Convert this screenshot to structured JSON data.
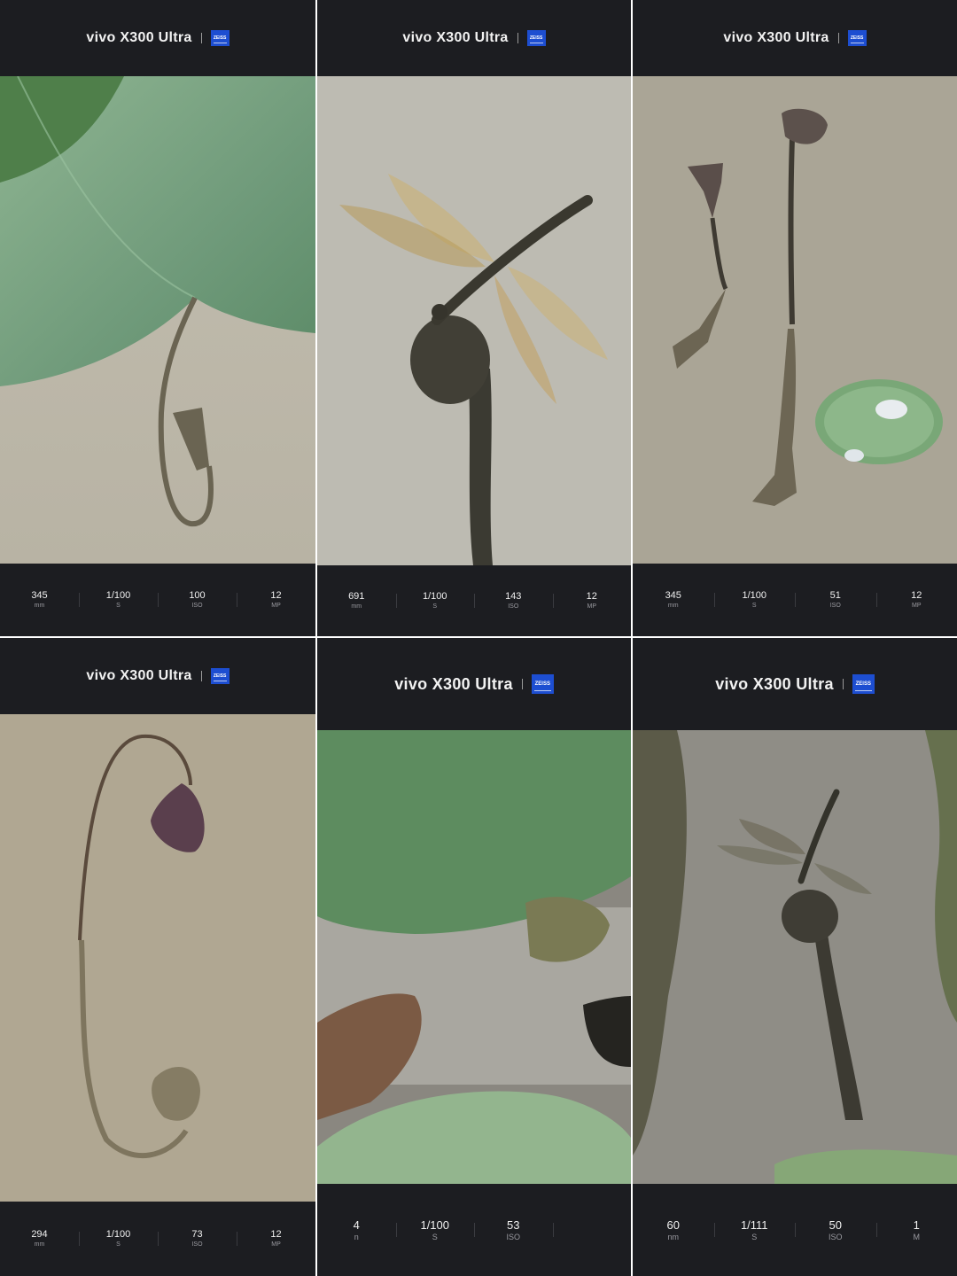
{
  "panels": [
    {
      "brand": "vivo X300 Ultra",
      "zeiss": "ZEISS",
      "stats": [
        {
          "value": "345",
          "unit": "mm"
        },
        {
          "value": "1/100",
          "unit": "S"
        },
        {
          "value": "100",
          "unit": "ISO"
        },
        {
          "value": "12",
          "unit": "MP"
        }
      ]
    },
    {
      "brand": "vivo X300 Ultra",
      "zeiss": "ZEISS",
      "stats": [
        {
          "value": "691",
          "unit": "mm"
        },
        {
          "value": "1/100",
          "unit": "S"
        },
        {
          "value": "143",
          "unit": "ISO"
        },
        {
          "value": "12",
          "unit": "MP"
        }
      ]
    },
    {
      "brand": "vivo X300 Ultra",
      "zeiss": "ZEISS",
      "stats": [
        {
          "value": "345",
          "unit": "mm"
        },
        {
          "value": "1/100",
          "unit": "S"
        },
        {
          "value": "51",
          "unit": "ISO"
        },
        {
          "value": "12",
          "unit": "MP"
        }
      ]
    },
    {
      "brand": "vivo X300 Ultra",
      "zeiss": "ZEISS",
      "stats": [
        {
          "value": "294",
          "unit": "mm"
        },
        {
          "value": "1/100",
          "unit": "S"
        },
        {
          "value": "73",
          "unit": "ISO"
        },
        {
          "value": "12",
          "unit": "MP"
        }
      ]
    },
    {
      "brand": "vivo X300 Ultra",
      "zeiss": "ZEISS",
      "stats": [
        {
          "value": "4",
          "unit": "n"
        },
        {
          "value": "1/100",
          "unit": "S"
        },
        {
          "value": "53",
          "unit": "ISO"
        }
      ]
    },
    {
      "brand": "vivo X300 Ultra",
      "zeiss": "ZEISS",
      "stats": [
        {
          "value": "60",
          "unit": "nm"
        },
        {
          "value": "1/111",
          "unit": "S"
        },
        {
          "value": "50",
          "unit": "ISO"
        },
        {
          "value": "1",
          "unit": "M"
        }
      ]
    }
  ],
  "colors": {
    "frame": "#1c1d21",
    "zeiss_blue": "#1d4ed1",
    "leaf": "#6f9a6a",
    "water": "#bdb9aa"
  }
}
